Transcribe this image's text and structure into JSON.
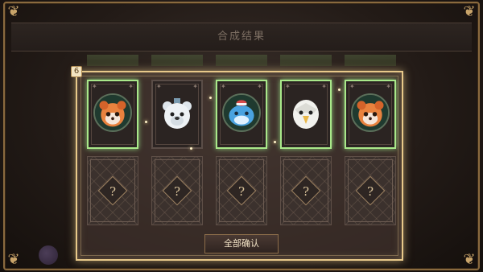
{
  "dialog": {
    "title": "合成结果",
    "count_badge": "6",
    "confirm_label": "全部确认"
  },
  "result_cards": [
    {
      "creature": "red-panda",
      "highlighted": true
    },
    {
      "creature": "polar-bear",
      "highlighted": false
    },
    {
      "creature": "dolphin",
      "highlighted": true
    },
    {
      "creature": "eagle",
      "highlighted": true
    },
    {
      "creature": "red-panda",
      "highlighted": true
    }
  ],
  "hidden_cards": [
    {
      "symbol": "?"
    },
    {
      "symbol": "?"
    },
    {
      "symbol": "?"
    },
    {
      "symbol": "?"
    },
    {
      "symbol": "?"
    }
  ],
  "colors": {
    "highlight_border": "#a9e88a",
    "panel_border": "#e8c98a",
    "frame_gold": "#8a6a3e"
  }
}
